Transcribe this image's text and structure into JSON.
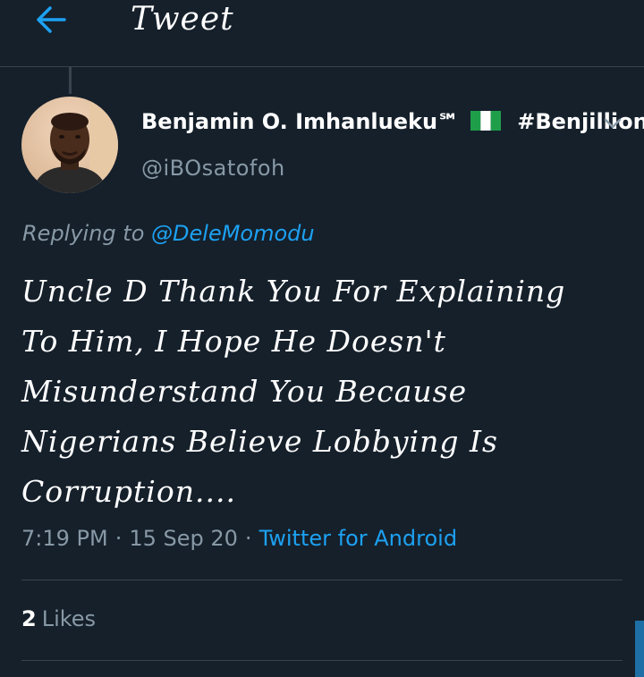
{
  "header": {
    "title": "Tweet",
    "back_icon": "arrow-left-icon"
  },
  "author": {
    "display_name": "Benjamin O. Imhanlueku℠",
    "flag": "nigeria-flag-icon",
    "hashtag": "#Benjillion",
    "handle": "@iBOsatofoh"
  },
  "reply": {
    "prefix": "Replying to",
    "mention": "@DeleMomodu"
  },
  "tweet": {
    "text_lines": [
      "Uncle D Thank You For Explaining",
      "To Him, I Hope He Doesn't",
      "Misunderstand You Because",
      "Nigerians Believe Lobbying Is",
      "Corruption...."
    ]
  },
  "meta": {
    "time": "7:19 PM",
    "date": "15 Sep 20",
    "separator": "·",
    "source": "Twitter for Android"
  },
  "stats": {
    "likes_count": "2",
    "likes_label": "Likes"
  },
  "colors": {
    "background": "#15202b",
    "accent": "#1da1f2",
    "secondary_text": "#8899a6",
    "divider": "#38444d"
  }
}
